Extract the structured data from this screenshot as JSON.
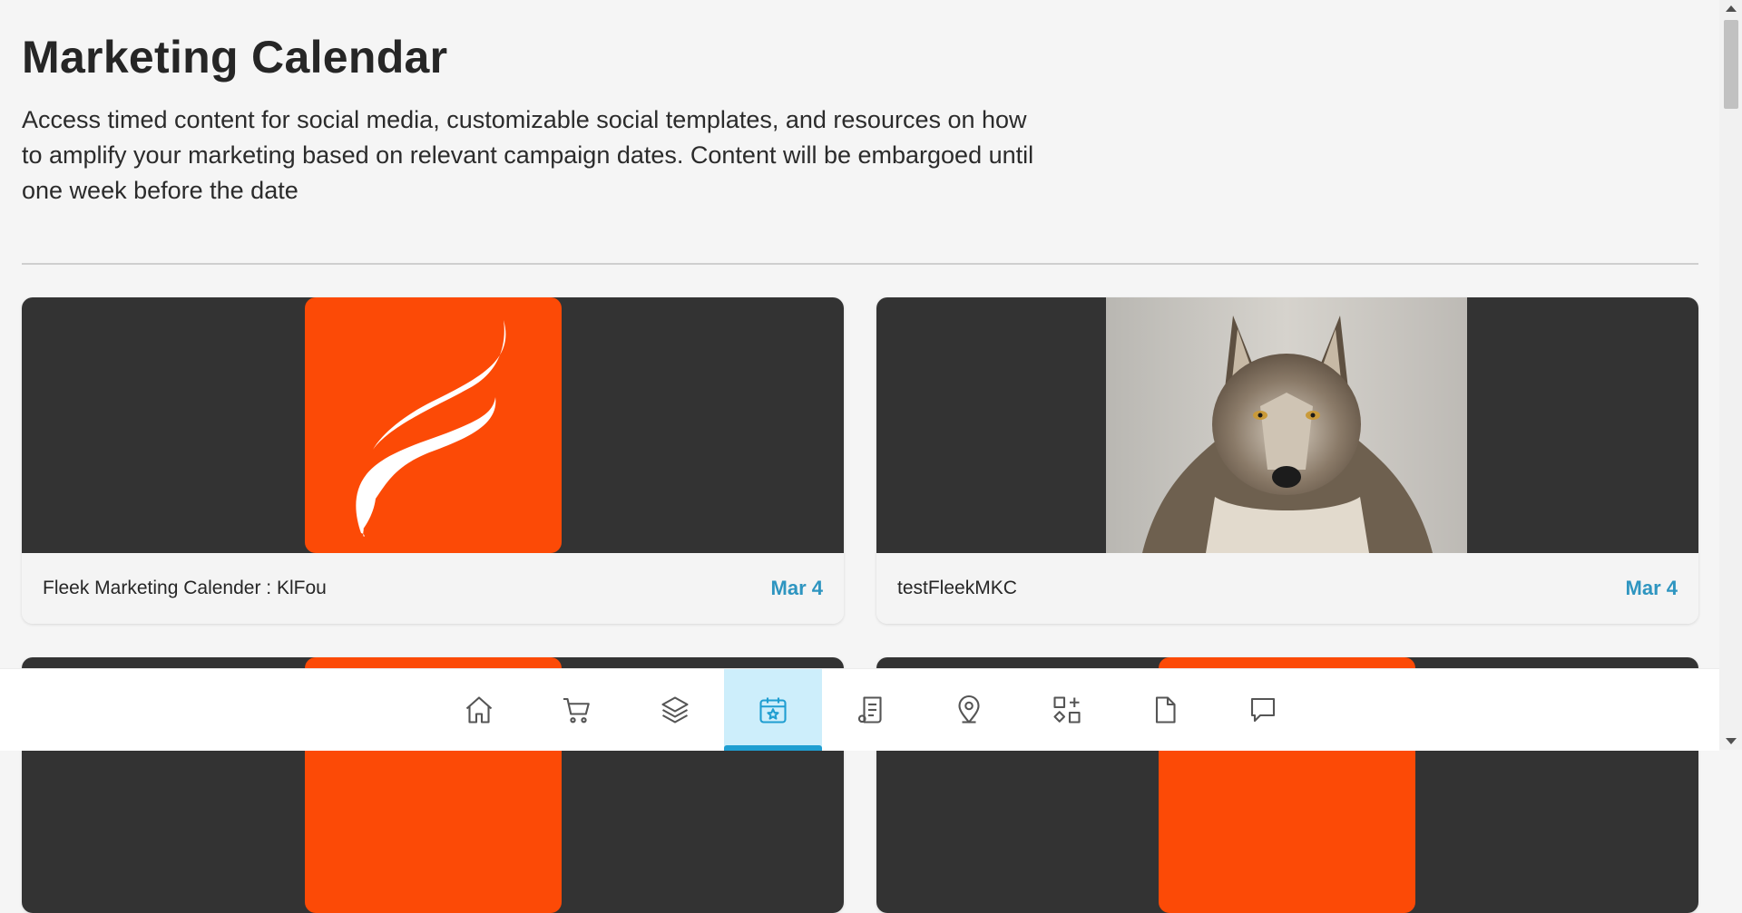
{
  "page": {
    "title": "Marketing Calendar",
    "description": "Access timed content for social media, customizable social templates, and resources on how to amplify your marketing based on relevant campaign dates. Content will be embargoed until one week before the date"
  },
  "cards": [
    {
      "title": "Fleek Marketing Calender : KlFou",
      "date": "Mar 4",
      "image": "fleek-logo"
    },
    {
      "title": "testFleekMKC",
      "date": "Mar 4",
      "image": "wolf-photo"
    },
    {
      "title": "",
      "date": "",
      "image": "fleek-logo"
    },
    {
      "title": "",
      "date": "",
      "image": "fleek-logo"
    }
  ],
  "nav": {
    "active": "calendar",
    "items": [
      {
        "id": "home",
        "icon": "home-icon"
      },
      {
        "id": "cart",
        "icon": "cart-icon"
      },
      {
        "id": "layers",
        "icon": "layers-icon"
      },
      {
        "id": "calendar",
        "icon": "calendar-star-icon"
      },
      {
        "id": "document-list",
        "icon": "document-list-icon"
      },
      {
        "id": "location",
        "icon": "map-pin-icon"
      },
      {
        "id": "apps",
        "icon": "apps-add-icon"
      },
      {
        "id": "file",
        "icon": "file-icon"
      },
      {
        "id": "messages",
        "icon": "chat-icon"
      }
    ]
  },
  "colors": {
    "accent": "#2e95c0",
    "active_nav_bg": "#cdeefb",
    "active_nav_bar": "#1f9ed1",
    "logo_orange": "#fc4a06",
    "media_bg": "#333333",
    "page_bg": "#f5f5f5"
  }
}
